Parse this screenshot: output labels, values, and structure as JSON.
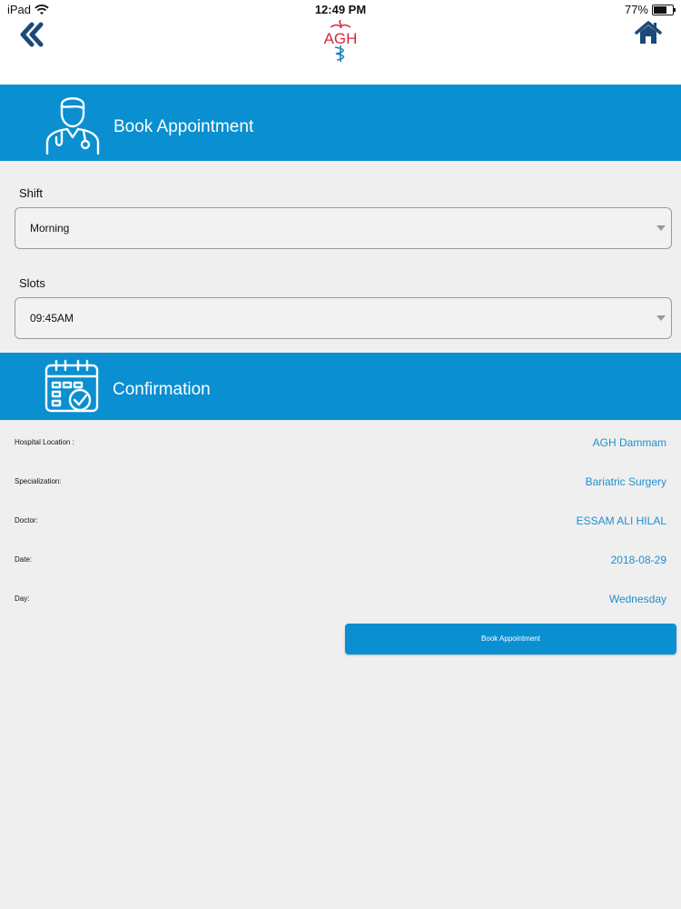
{
  "status_bar": {
    "device": "iPad",
    "time": "12:49 PM",
    "battery_percent": "77%",
    "battery_level": 0.77,
    "wifi_icon": "wifi-icon"
  },
  "nav": {
    "back_icon": "double-chevron-left-icon",
    "home_icon": "home-icon",
    "logo_text": "AGH"
  },
  "book_section": {
    "title": "Book Appointment",
    "icon": "doctor-icon"
  },
  "shift": {
    "label": "Shift",
    "value": "Morning"
  },
  "slots": {
    "label": "Slots",
    "value": "09:45AM"
  },
  "confirmation": {
    "title": "Confirmation",
    "icon": "calendar-check-icon",
    "rows": [
      {
        "label": "Hospital Location :",
        "value": "AGH Dammam"
      },
      {
        "label": "Specialization:",
        "value": "Bariatric Surgery"
      },
      {
        "label": "Doctor:",
        "value": "ESSAM ALI HILAL"
      },
      {
        "label": "Date:",
        "value": "2018-08-29"
      },
      {
        "label": "Day:",
        "value": "Wednesday"
      }
    ]
  },
  "book_button": {
    "label": "Book Appointment"
  },
  "colors": {
    "accent": "#0a8fd1",
    "value_text": "#1f8fcd",
    "background": "#f0eff0"
  }
}
